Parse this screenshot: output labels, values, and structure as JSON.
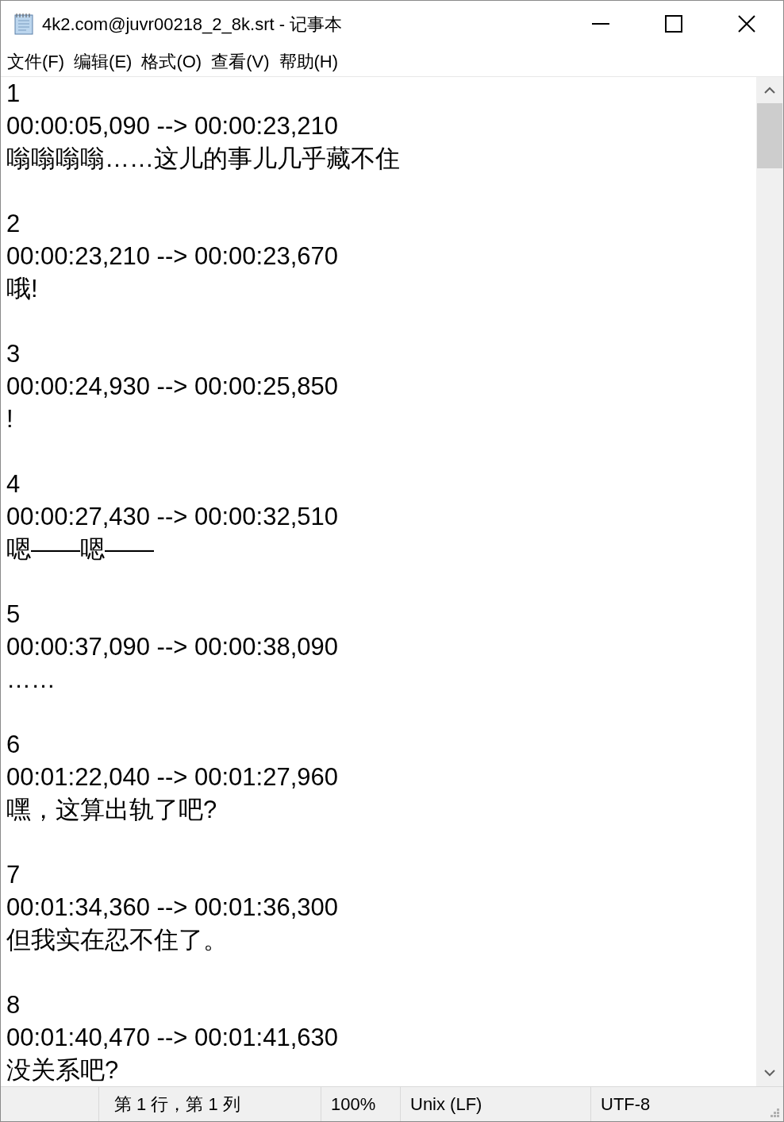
{
  "window": {
    "title": "4k2.com@juvr00218_2_8k.srt - 记事本"
  },
  "menu": [
    "文件(F)",
    "编辑(E)",
    "格式(O)",
    "查看(V)",
    "帮助(H)"
  ],
  "subtitles": [
    {
      "index": "1",
      "timing": "00:00:05,090 --> 00:00:23,210",
      "text": "嗡嗡嗡嗡……这儿的事儿几乎藏不住"
    },
    {
      "index": "2",
      "timing": "00:00:23,210 --> 00:00:23,670",
      "text": "哦!"
    },
    {
      "index": "3",
      "timing": "00:00:24,930 --> 00:00:25,850",
      "text": "!"
    },
    {
      "index": "4",
      "timing": "00:00:27,430 --> 00:00:32,510",
      "text": "嗯——嗯——"
    },
    {
      "index": "5",
      "timing": "00:00:37,090 --> 00:00:38,090",
      "text": "……"
    },
    {
      "index": "6",
      "timing": "00:01:22,040 --> 00:01:27,960",
      "text": "嘿，这算出轨了吧?"
    },
    {
      "index": "7",
      "timing": "00:01:34,360 --> 00:01:36,300",
      "text": "但我实在忍不住了。"
    },
    {
      "index": "8",
      "timing": "00:01:40,470 --> 00:01:41,630",
      "text": "没关系吧?"
    }
  ],
  "status_bar": {
    "position": "第 1 行，第 1 列",
    "zoom": "100%",
    "line_ending": "Unix (LF)",
    "encoding": "UTF-8"
  }
}
